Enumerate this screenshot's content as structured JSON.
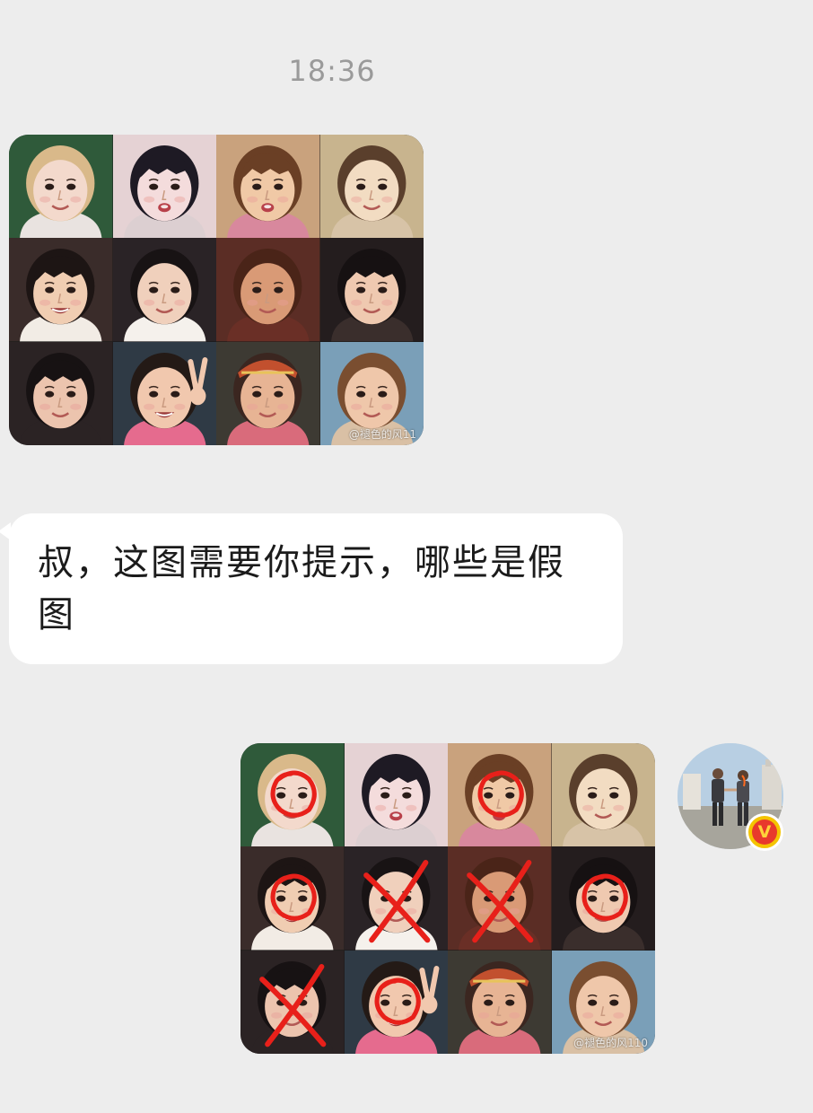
{
  "chat": {
    "timestamp": "18:36",
    "received_image": {
      "watermark": "@褪色的风11",
      "tiles": 12
    },
    "received_text": "叔，这图需要你提示，哪些是假图",
    "sent_image": {
      "watermark": "@褪色的风110",
      "annotations": [
        "circle",
        "none",
        "circle",
        "none",
        "circle",
        "cross",
        "cross",
        "circle",
        "cross",
        "circle",
        "none",
        "none"
      ]
    },
    "sender_avatar": {
      "icon": "avatar",
      "badge": "V"
    }
  },
  "colors": {
    "background": "#ededed",
    "bubble": "#ffffff",
    "annotation": "#e8201a",
    "badge_yellow": "#f4c400",
    "badge_red": "#e8392c"
  }
}
